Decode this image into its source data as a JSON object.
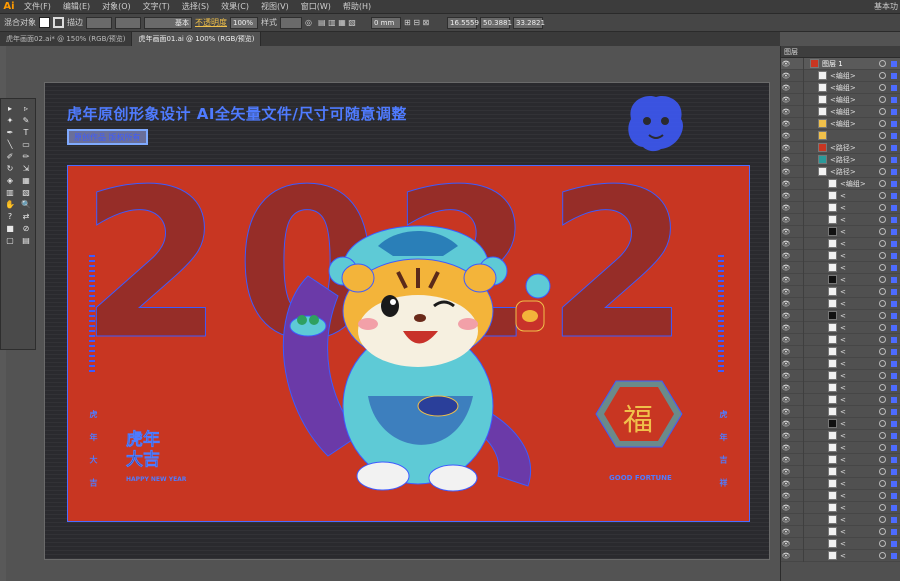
{
  "app": {
    "logo": "Ai",
    "workspace": "基本功"
  },
  "menu": [
    "文件(F)",
    "编辑(E)",
    "对象(O)",
    "文字(T)",
    "选择(S)",
    "效果(C)",
    "视图(V)",
    "窗口(W)",
    "帮助(H)"
  ],
  "control_bar": {
    "selection_label": "混合对象",
    "stroke_label": "描边",
    "brush_label": "基本",
    "opacity_label": "不透明度",
    "opacity_value": "100%",
    "style_label": "样式",
    "x_value": "16.5559",
    "y_value": "50.3881",
    "w_value": "33.2821",
    "corner_value": "0 mm"
  },
  "tabs": [
    {
      "label": "虎年画面02.ai* @ 150% (RGB/预览)"
    },
    {
      "label": "虎年画面01.ai @ 100% (RGB/预览)"
    }
  ],
  "tools": [
    "▸",
    "▹",
    "✦",
    "✎",
    "✒",
    "T",
    "╲",
    "▭",
    "✐",
    "✏",
    "↻",
    "⇲",
    "◈",
    "▦",
    "▥",
    "▧",
    "✋",
    "🔍",
    "?",
    "⇄",
    "■",
    "⊘",
    "▢",
    "▤"
  ],
  "artboard": {
    "title": "虎年原创形象设计 AI全矢量文件/尺寸可随意调整",
    "subtitle": "原创作品 版权所有",
    "year": "2022",
    "fu": "福",
    "fu_sub": "GOOD FORTUNE",
    "left_vertical": "虎 年 大 吉",
    "right_vertical": "虎 年 吉 祥",
    "daji_top": "虎年",
    "daji_bottom": "大吉",
    "daji_sub": "HAPPY NEW YEAR"
  },
  "layers_panel": {
    "title": "图层",
    "rows": [
      {
        "name": "图层 1",
        "top": true,
        "thumb": "#c83622"
      },
      {
        "name": "<编组>",
        "thumb": "#f2f2f2"
      },
      {
        "name": "<编组>",
        "thumb": "#f2f2f2"
      },
      {
        "name": "<编组>",
        "thumb": "#f2f2f2"
      },
      {
        "name": "<编组>",
        "thumb": "#f2f2f2"
      },
      {
        "name": "<编组>",
        "thumb": "#f0c04a"
      },
      {
        "name": "",
        "thumb": "#f0c04a"
      },
      {
        "name": "<路径>",
        "thumb": "#c83622"
      },
      {
        "name": "<路径>",
        "thumb": "#2a9a9a"
      },
      {
        "name": "<路径>",
        "thumb": "#f2f2f2"
      },
      {
        "name": "<编组>",
        "thumb": "#f2f2f2"
      },
      {
        "name": "<",
        "thumb": "#f2f2f2"
      },
      {
        "name": "<",
        "thumb": "#f2f2f2"
      },
      {
        "name": "<",
        "thumb": "#f2f2f2"
      },
      {
        "name": "<",
        "thumb": "#111111"
      },
      {
        "name": "<",
        "thumb": "#f2f2f2"
      },
      {
        "name": "<",
        "thumb": "#f2f2f2"
      },
      {
        "name": "<",
        "thumb": "#f2f2f2"
      },
      {
        "name": "<",
        "thumb": "#111111"
      },
      {
        "name": "<",
        "thumb": "#f2f2f2"
      },
      {
        "name": "<",
        "thumb": "#f2f2f2"
      },
      {
        "name": "<",
        "thumb": "#111111"
      },
      {
        "name": "<",
        "thumb": "#f2f2f2"
      },
      {
        "name": "<",
        "thumb": "#f2f2f2"
      },
      {
        "name": "<",
        "thumb": "#f2f2f2"
      },
      {
        "name": "<",
        "thumb": "#f2f2f2"
      },
      {
        "name": "<",
        "thumb": "#f2f2f2"
      },
      {
        "name": "<",
        "thumb": "#f2f2f2"
      },
      {
        "name": "<",
        "thumb": "#f2f2f2"
      },
      {
        "name": "<",
        "thumb": "#f2f2f2"
      },
      {
        "name": "<",
        "thumb": "#111111"
      },
      {
        "name": "<",
        "thumb": "#f2f2f2"
      },
      {
        "name": "<",
        "thumb": "#f2f2f2"
      },
      {
        "name": "<",
        "thumb": "#f2f2f2"
      },
      {
        "name": "<",
        "thumb": "#f2f2f2"
      },
      {
        "name": "<",
        "thumb": "#f2f2f2"
      },
      {
        "name": "<",
        "thumb": "#f2f2f2"
      },
      {
        "name": "<",
        "thumb": "#f2f2f2"
      },
      {
        "name": "<",
        "thumb": "#f2f2f2"
      },
      {
        "name": "<",
        "thumb": "#f2f2f2"
      },
      {
        "name": "<",
        "thumb": "#f2f2f2"
      },
      {
        "name": "<",
        "thumb": "#f2f2f2"
      }
    ]
  },
  "colors": {
    "red": "#c83622",
    "dark_red": "#962d28",
    "selection_blue": "#4d6bff",
    "gold": "#f0c04a"
  }
}
